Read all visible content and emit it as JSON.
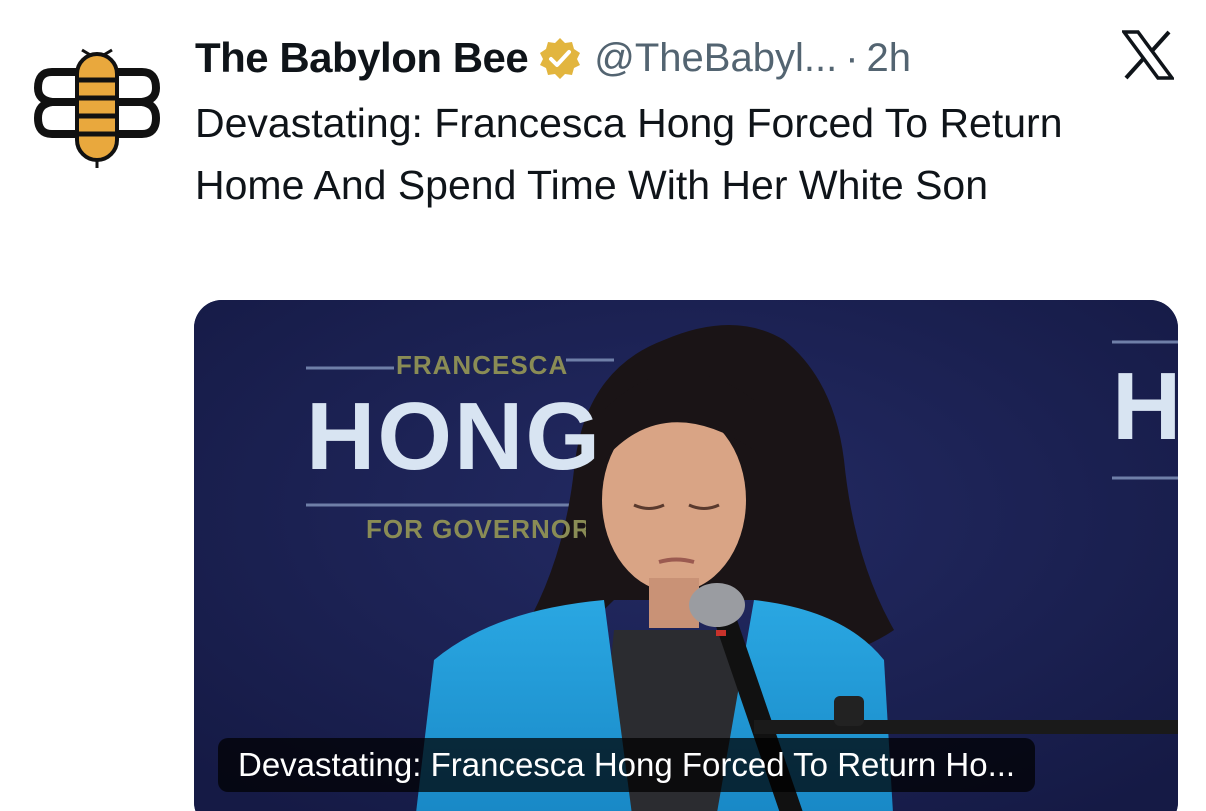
{
  "account": {
    "display_name": "The Babylon Bee",
    "handle": "@TheBabyl...",
    "separator": "·",
    "time": "2h",
    "verified_icon": "verified-badge-icon",
    "avatar_icon": "babylon-bee-logo"
  },
  "tweet": {
    "text": "Devastating: Francesca Hong Forced To Return Home And Spend Time With Her White Son"
  },
  "media": {
    "banner_top": "FRANCESCA",
    "banner_main": "HONG",
    "banner_sub": "FOR GOVERNOR",
    "banner_right": "H",
    "caption": "Devastating: Francesca Hong Forced To Return Ho..."
  },
  "platform": {
    "logo_icon": "x-logo-icon"
  },
  "colors": {
    "accent_gold": "#e9a83d",
    "stage_navy": "#1d2254",
    "blazer_blue": "#1e9bd7"
  }
}
